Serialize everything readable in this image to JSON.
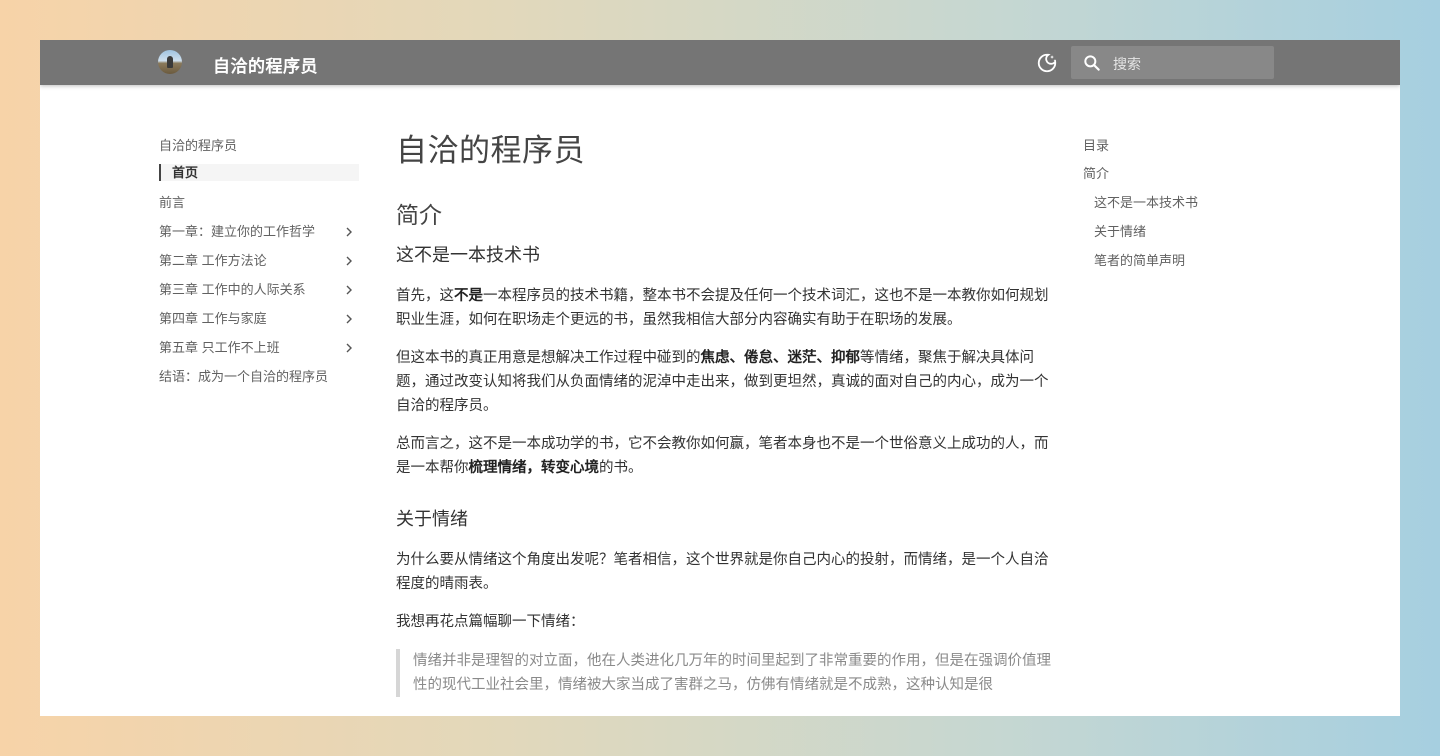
{
  "header": {
    "site_title": "自洽的程序员",
    "search_placeholder": "搜索"
  },
  "nav": {
    "title": "自洽的程序员",
    "items": [
      {
        "label": "首页",
        "active": true,
        "has_children": false
      },
      {
        "label": "前言",
        "active": false,
        "has_children": false
      },
      {
        "label": "第一章：建立你的工作哲学",
        "active": false,
        "has_children": true
      },
      {
        "label": "第二章 工作方法论",
        "active": false,
        "has_children": true
      },
      {
        "label": "第三章 工作中的人际关系",
        "active": false,
        "has_children": true
      },
      {
        "label": "第四章 工作与家庭",
        "active": false,
        "has_children": true
      },
      {
        "label": "第五章 只工作不上班",
        "active": false,
        "has_children": true
      },
      {
        "label": "结语：成为一个自洽的程序员",
        "active": false,
        "has_children": false
      }
    ]
  },
  "content": {
    "page_title": "自洽的程序员",
    "section_title": "简介",
    "sub1_title": "这不是一本技术书",
    "p1": {
      "a": "首先，这",
      "b1": "不是",
      "c": "一本程序员的技术书籍，整本书不会提及任何一个技术词汇，这也不是一本教你如何规划职业生涯，如何在职场走个更远的书，虽然我相信大部分内容确实有助于在职场的发展。"
    },
    "p2": {
      "a": "但这本书的真正用意是想解决工作过程中碰到的",
      "b1": "焦虑",
      "sep1": "、",
      "b2": "倦怠",
      "sep2": "、",
      "b3": "迷茫",
      "sep3": "、",
      "b4": "抑郁",
      "c": "等情绪，聚焦于解决具体问题，通过改变认知将我们从负面情绪的泥淖中走出来，做到更坦然，真诚的面对自己的内心，成为一个自洽的程序员。"
    },
    "p3": {
      "a": "总而言之，这不是一本成功学的书，它不会教你如何赢，笔者本身也不是一个世俗意义上成功的人，而是一本帮你",
      "b1": "梳理情绪，转变心境",
      "c": "的书。"
    },
    "sub2_title": "关于情绪",
    "p4": "为什么要从情绪这个角度出发呢？笔者相信，这个世界就是你自己内心的投射，而情绪，是一个人自洽程度的晴雨表。",
    "p5": "我想再花点篇幅聊一下情绪：",
    "quote": "情绪并非是理智的对立面，他在人类进化几万年的时间里起到了非常重要的作用，但是在强调价值理性的现代工业社会里，情绪被大家当成了害群之马，仿佛有情绪就是不成熟，这种认知是很"
  },
  "toc": {
    "title": "目录",
    "items": [
      {
        "label": "简介",
        "level": 1
      },
      {
        "label": "这不是一本技术书",
        "level": 2
      },
      {
        "label": "关于情绪",
        "level": 2
      },
      {
        "label": "笔者的简单声明",
        "level": 2
      }
    ]
  }
}
